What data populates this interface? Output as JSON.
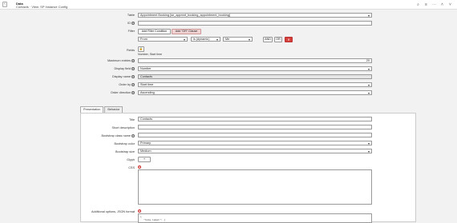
{
  "topbar": {
    "title": "Data",
    "subtitle": "Contacts · View: SP Instance Config",
    "back_icon": "‹",
    "icons": [
      "paperclip-icon",
      "sliders-icon",
      "more-icon",
      "chevron-up-icon",
      "chevron-down-icon"
    ],
    "icon_glyphs": [
      "⌕",
      "≡",
      "⋯",
      "˄",
      "˅"
    ]
  },
  "form": {
    "table": {
      "label": "Table",
      "value": "Appointment Booking [sn_appmnt_booking_appointment_booking]"
    },
    "id": {
      "label": "ID",
      "value": ""
    },
    "filter": {
      "label": "Filter",
      "add_condition": "Add Filter Condition",
      "add_or": "Add \"OR\" Clause",
      "field": "From",
      "operator": "is (dynamic)",
      "value": "Me",
      "and": "AND",
      "or": "OR",
      "remove": "✕"
    },
    "fields": {
      "label": "Fields",
      "lock_icon": "🔒",
      "value": "Number, Start time"
    },
    "maximum_entries": {
      "label": "Maximum entries",
      "value": "20"
    },
    "display_field": {
      "label": "Display field",
      "value": "Number"
    },
    "display_name": {
      "label": "Display name",
      "value": "Contacts"
    },
    "order_by": {
      "label": "Order by",
      "value": "Start time"
    },
    "order_direction": {
      "label": "Order direction",
      "value": "Ascending"
    }
  },
  "tabs": [
    {
      "label": "Presentation"
    },
    {
      "label": "Behavior"
    }
  ],
  "presentation": {
    "title": {
      "label": "Title",
      "value": "Contacts"
    },
    "short_description": {
      "label": "Short description",
      "value": ""
    },
    "bootstrap_class_name": {
      "label": "Bootstrap class name",
      "value": ""
    },
    "bootstrap_color": {
      "label": "Bootstrap color",
      "value": "Primary"
    },
    "bootstrap_size": {
      "label": "Bootstrap size",
      "value": "Medium"
    },
    "glyph": {
      "label": "Glyph",
      "value": "+"
    },
    "css": {
      "label": "CSS"
    },
    "additional_options": {
      "label": "Additional options, JSON format",
      "code_line1": "{",
      "code_line2": "\"hide_label\": {"
    }
  }
}
